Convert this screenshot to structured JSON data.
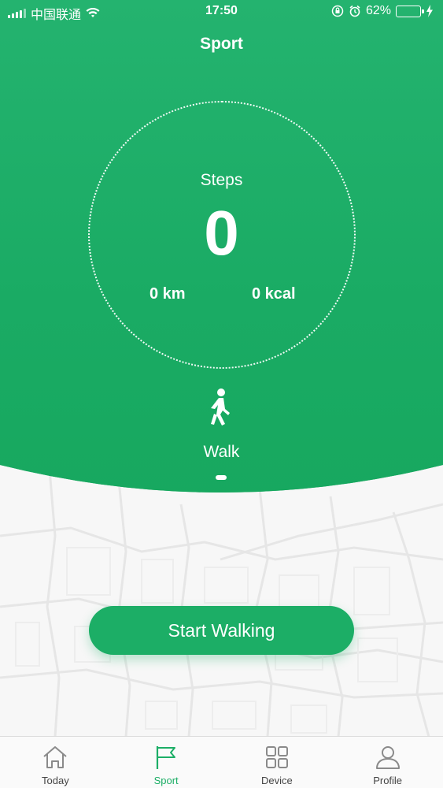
{
  "status_bar": {
    "carrier": "中国联通",
    "time": "17:50",
    "battery_percent": "62%",
    "battery_level": 0.62
  },
  "header": {
    "title": "Sport"
  },
  "summary": {
    "steps_label": "Steps",
    "steps_value": "0",
    "distance": "0 km",
    "calories": "0 kcal"
  },
  "mode": {
    "label": "Walk",
    "icon": "walking-person-icon"
  },
  "actions": {
    "start_label": "Start Walking"
  },
  "tabbar": {
    "tabs": [
      {
        "label": "Today",
        "icon": "home-icon",
        "active": false
      },
      {
        "label": "Sport",
        "icon": "flag-icon",
        "active": true
      },
      {
        "label": "Device",
        "icon": "grid-icon",
        "active": false
      },
      {
        "label": "Profile",
        "icon": "person-icon",
        "active": false
      }
    ]
  },
  "colors": {
    "accent": "#1cae66",
    "battery": "#ffd21f",
    "inactive_tab": "#444444"
  }
}
